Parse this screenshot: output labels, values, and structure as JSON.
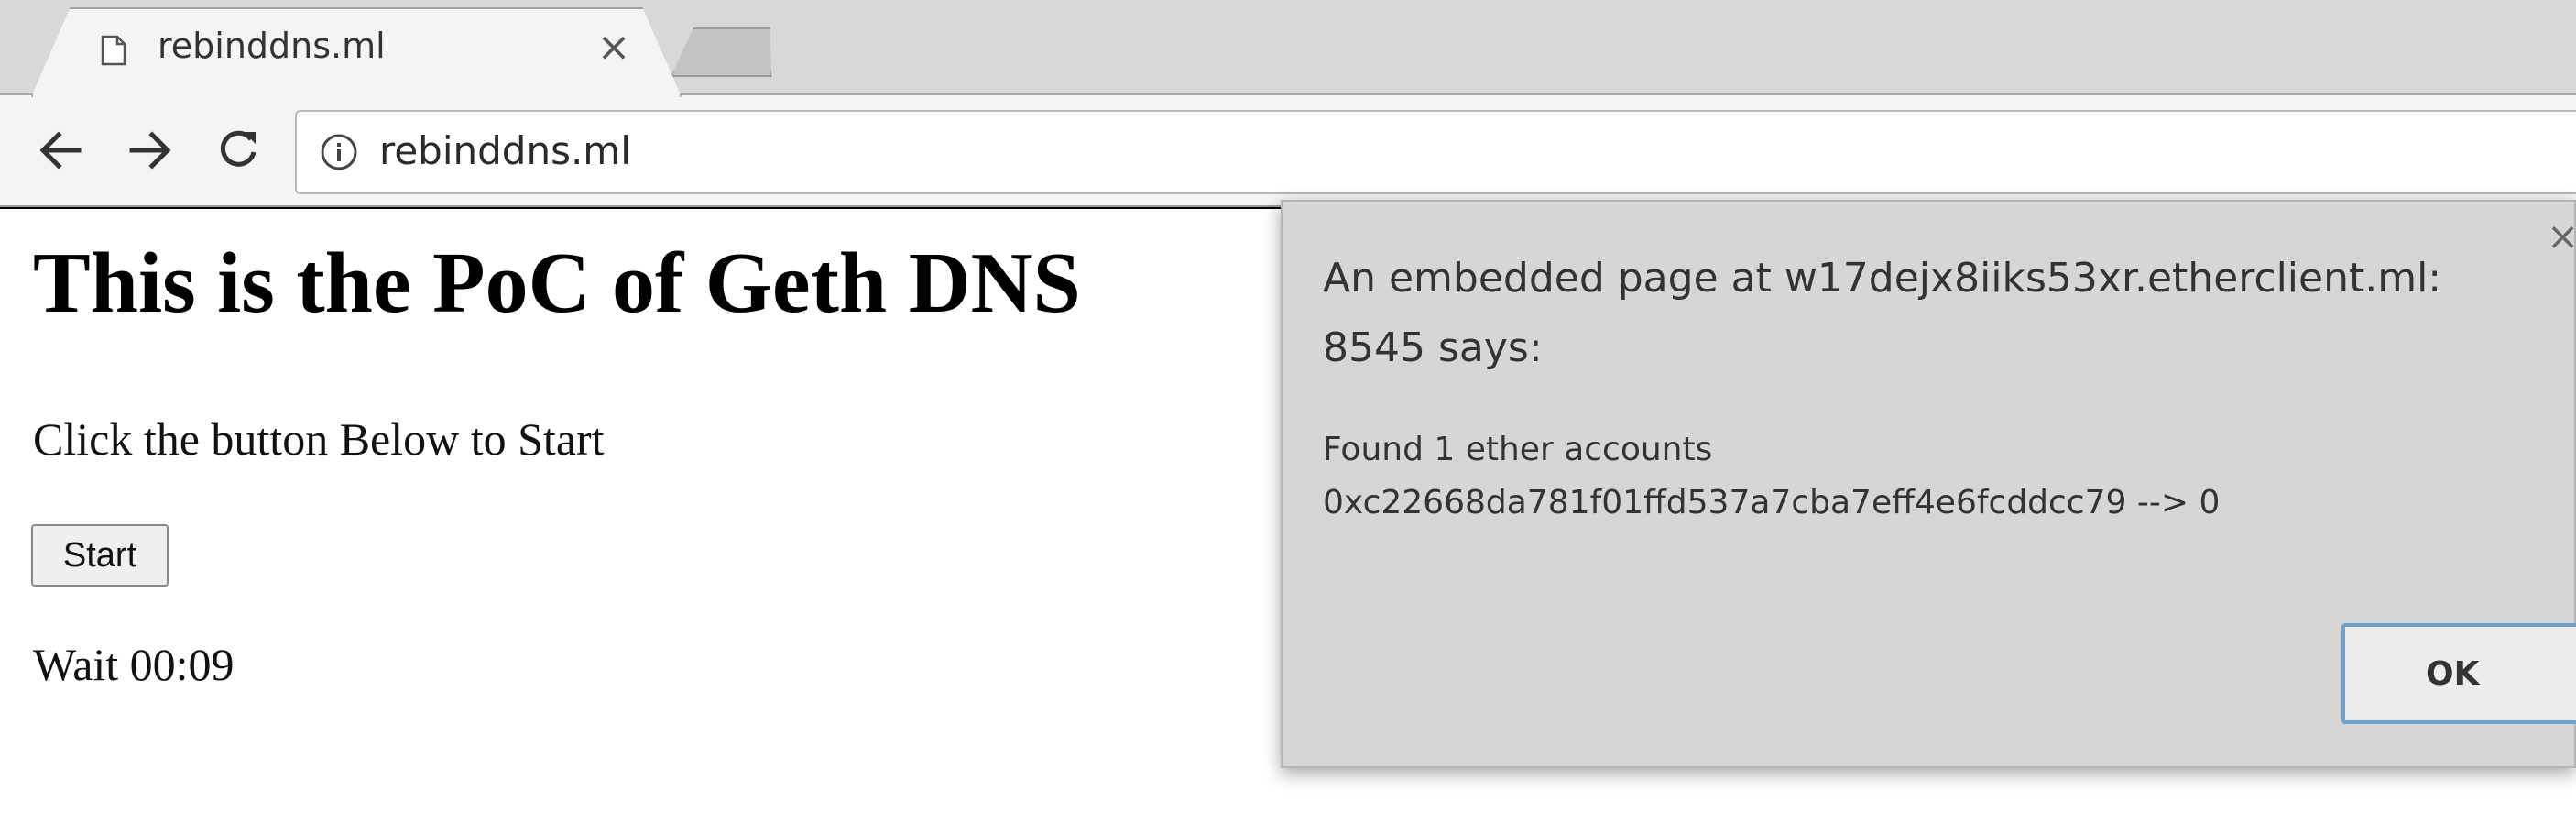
{
  "browser": {
    "tab": {
      "title": "rebinddns.ml",
      "page_icon": "page-icon",
      "close_symbol": "×"
    },
    "toolbar": {
      "back_icon": "back-arrow-icon",
      "forward_icon": "forward-arrow-icon",
      "reload_icon": "reload-icon",
      "info_icon": "info-icon",
      "url": "rebinddns.ml"
    }
  },
  "page": {
    "title": "This is the PoC of Geth DNS",
    "instruction": "Click the button Below to Start",
    "start_button": "Start",
    "wait_text": "Wait 00:09"
  },
  "dialog": {
    "heading_line1": "An embedded page at w17dejx8iiks53xr.etherclient.ml:",
    "heading_line2": "8545 says:",
    "message_line1": "Found 1 ether accounts",
    "message_line2": "0xc22668da781f01ffd537a7cba7eff4e6fcddcc79 --> 0",
    "ok_label": "OK",
    "close_symbol": "×",
    "ok_border_color": "#6fa1c9"
  }
}
